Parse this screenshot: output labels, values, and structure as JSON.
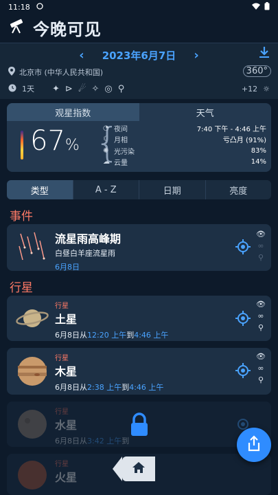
{
  "status_bar": {
    "time": "11:18"
  },
  "app": {
    "title": "今晚可见"
  },
  "controls": {
    "prev_label": "‹",
    "date": "2023年6月7日",
    "next_label": "›",
    "location": "北京市 (中华人民共和国)",
    "badge": "360°",
    "duration": "1天",
    "tz_offset": "+12"
  },
  "index_card": {
    "tabs": [
      "观星指数",
      "天气"
    ],
    "percent_value": "67",
    "percent_sign": "%",
    "metrics": [
      {
        "label": "夜间",
        "value": "7:40 下午 - 4:46 上午"
      },
      {
        "label": "月相",
        "value": "亏凸月 (91%)"
      },
      {
        "label": "光污染",
        "value": "83%"
      },
      {
        "label": "云量",
        "value": "14%"
      }
    ]
  },
  "sort_tabs": [
    "类型",
    "A - Z",
    "日期",
    "亮度"
  ],
  "sections": {
    "events": "事件",
    "planets": "行星"
  },
  "event_card": {
    "name": "流星雨高峰期",
    "sub": "白昼白羊座流星雨",
    "date": "6月8日"
  },
  "planet_cards": [
    {
      "category": "行星",
      "name": "土星",
      "date_prefix": "6月8日从",
      "start": "12:20 上午",
      "mid": "到",
      "end": "4:46 上午"
    },
    {
      "category": "行星",
      "name": "木星",
      "date_prefix": "6月8日从",
      "start": "2:38 上午",
      "mid": "到",
      "end": "4:46 上午"
    },
    {
      "category": "行星",
      "name": "水星",
      "date_prefix": "6月8日从",
      "start": "3:42 上午",
      "mid": "到",
      "end": ""
    },
    {
      "category": "行星",
      "name": "火星",
      "date_prefix": "",
      "start": "",
      "mid": "",
      "end": ""
    }
  ]
}
